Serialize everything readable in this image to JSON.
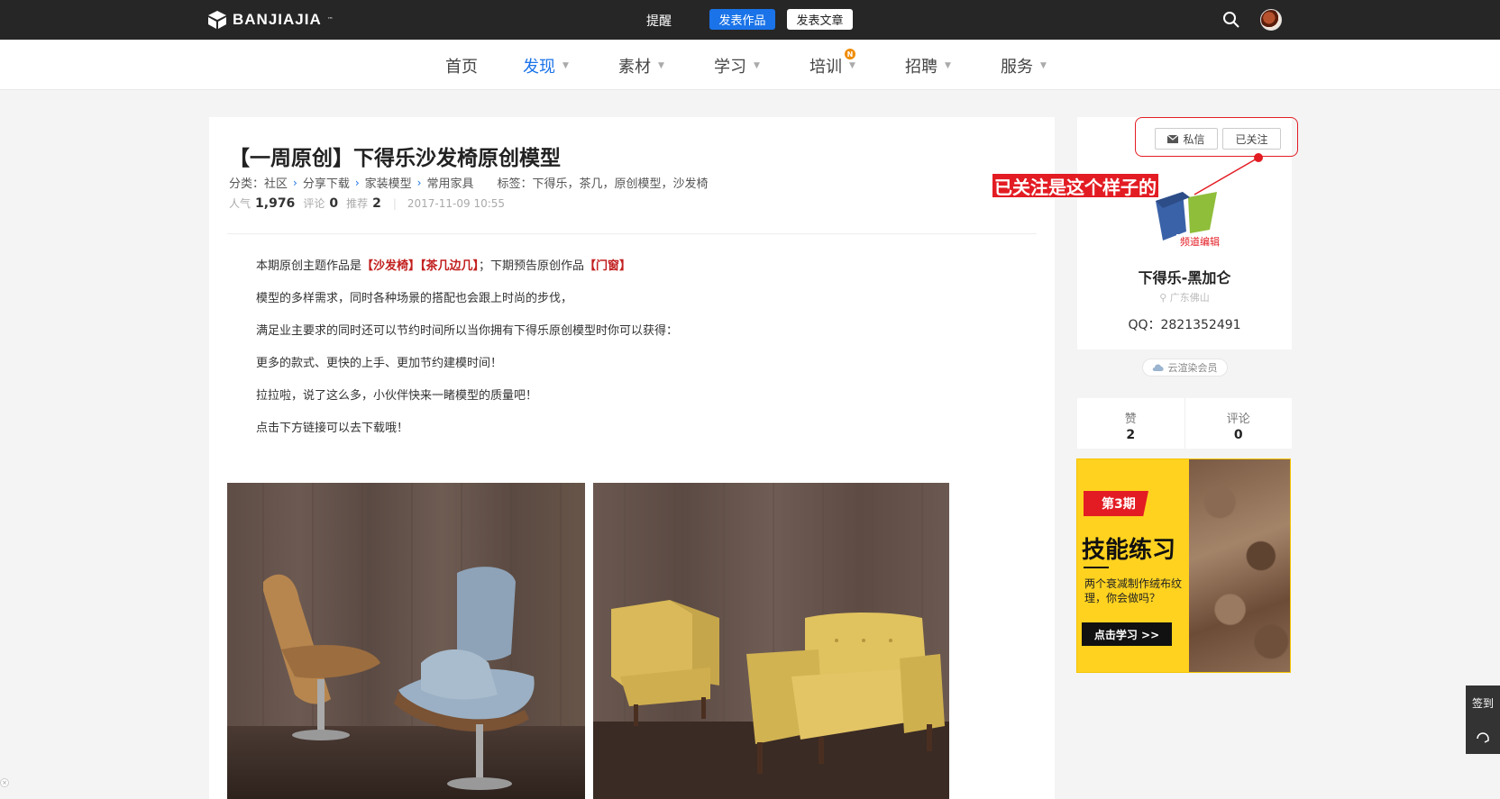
{
  "topbar": {
    "brand": "BANJIAJIA",
    "brand_tm": "™",
    "remind": "提醒",
    "publish_work": "发表作品",
    "publish_article": "发表文章"
  },
  "nav": {
    "items": [
      {
        "label": "首页"
      },
      {
        "label": "发现"
      },
      {
        "label": "素材"
      },
      {
        "label": "学习"
      },
      {
        "label": "培训"
      },
      {
        "label": "招聘"
      },
      {
        "label": "服务"
      }
    ],
    "new_badge": "N"
  },
  "post": {
    "title": "【一周原创】下得乐沙发椅原创模型",
    "category_prefix": "分类：社区",
    "crumbs": [
      "分享下载",
      "家装模型",
      "常用家具"
    ],
    "tags": "标签：下得乐，茶几，原创模型，沙发椅",
    "popularity_label": "人气",
    "popularity": "1,976",
    "comments_label": "评论",
    "comments": "0",
    "recommend_label": "推荐",
    "recommend": "2",
    "timestamp": "2017-11-09 10:55",
    "para1_a": "本期原创主题作品是",
    "para1_b": "【沙发椅】【茶几边几】",
    "para1_c": "；下期预告原创作品",
    "para1_d": "【门窗】",
    "para2": "模型的多样需求，同时各种场景的搭配也会跟上时尚的步伐，",
    "para3": "满足业主要求的同时还可以节约时间所以当你拥有下得乐原创模型时你可以获得：",
    "para4": "更多的款式、更快的上手、更加节约建模时间！",
    "para5": "拉拉啦，说了这么多，小伙伴快来一睹模型的质量吧！",
    "para6": "点击下方链接可以去下载哦！"
  },
  "author": {
    "dm_label": "私信",
    "follow_label": "已关注",
    "annotation": "已关注是这个样子的",
    "channel_tag": "频道编辑",
    "name": "下得乐-黑加仑",
    "location": "广东佛山",
    "qq": "QQ：2821352491",
    "member": "云渲染会员",
    "likes_label": "赞",
    "likes": "2",
    "comments_label": "评论",
    "comments": "0"
  },
  "ad": {
    "issue": "第3期",
    "title": "技能练习",
    "subtitle": "两个衰减制作绒布纹理，你会做吗？",
    "cta": "点击学习 >>"
  },
  "float": {
    "sign": "签到"
  },
  "colors": {
    "accent": "#1a73e8",
    "annotation_red": "#e31c23",
    "topbar": "#262626"
  }
}
